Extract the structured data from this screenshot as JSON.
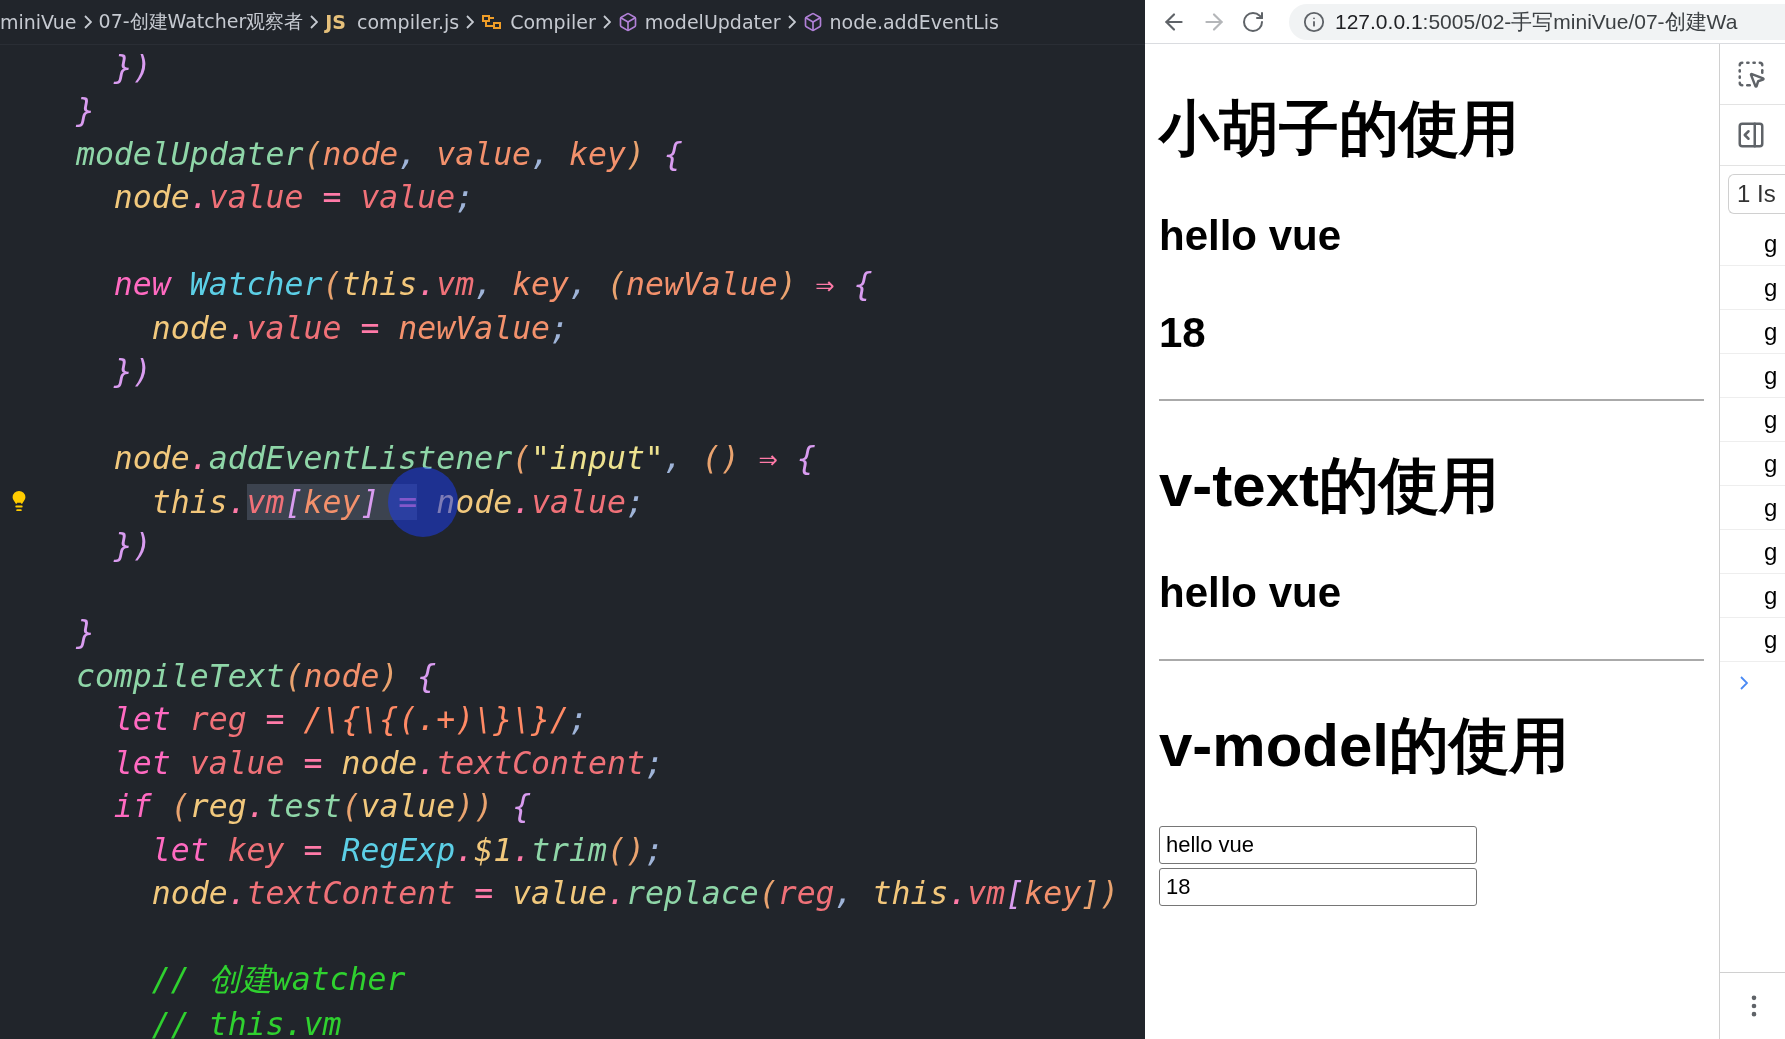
{
  "editor": {
    "breadcrumb": [
      {
        "kind": "folder",
        "label": "miniVue"
      },
      {
        "kind": "folder",
        "label": "07-创建Watcher观察者"
      },
      {
        "kind": "file",
        "badge": "JS",
        "label": "compiler.js"
      },
      {
        "kind": "class",
        "label": "Compiler"
      },
      {
        "kind": "method",
        "label": "modelUpdater"
      },
      {
        "kind": "method",
        "label": "node.addEventLis"
      }
    ],
    "lines": [
      {
        "children": [
          {
            "hint": false,
            "tokens": [
              {
                "text": "})",
                "kind": "brace"
              }
            ]
          }
        ]
      },
      {
        "hint": false,
        "tokens": [
          {
            "text": "}",
            "kind": "brace"
          }
        ]
      },
      {
        "hint": false,
        "tokens": [
          {
            "text": "modelUpdater",
            "kind": "fn"
          },
          {
            "text": "(",
            "kind": "paren"
          },
          {
            "text": "node",
            "kind": "param"
          },
          {
            "text": ", ",
            "kind": "punct"
          },
          {
            "text": "value",
            "kind": "param"
          },
          {
            "text": ", ",
            "kind": "punct"
          },
          {
            "text": "key",
            "kind": "param"
          },
          {
            "text": ")",
            "kind": "paren"
          },
          {
            "text": " {",
            "kind": "brace"
          }
        ],
        "children": [
          {
            "hint": false,
            "tokens": [
              {
                "text": "node",
                "kind": "var"
              },
              {
                "text": ".",
                "kind": "op"
              },
              {
                "text": "value",
                "kind": "prop"
              },
              {
                "text": " = ",
                "kind": "op"
              },
              {
                "text": "value",
                "kind": "prop"
              },
              {
                "text": ";",
                "kind": "punct"
              }
            ]
          },
          {
            "hint": false
          },
          {
            "hint": false,
            "tokens": [
              {
                "text": "new",
                "kind": "kw"
              },
              {
                "text": " Watcher",
                "kind": "cls"
              },
              {
                "text": "(",
                "kind": "paren"
              },
              {
                "text": "this",
                "kind": "this"
              },
              {
                "text": ".",
                "kind": "op"
              },
              {
                "text": "vm",
                "kind": "prop"
              },
              {
                "text": ", ",
                "kind": "punct"
              },
              {
                "text": "key",
                "kind": "param"
              },
              {
                "text": ", ",
                "kind": "punct"
              },
              {
                "text": "(",
                "kind": "paren"
              },
              {
                "text": "newValue",
                "kind": "param"
              },
              {
                "text": ")",
                "kind": "paren"
              },
              {
                "text": " ⇒ ",
                "kind": "op"
              },
              {
                "text": "{",
                "kind": "brace"
              }
            ],
            "children": [
              {
                "hint": false,
                "tokens": [
                  {
                    "text": "node",
                    "kind": "var"
                  },
                  {
                    "text": ".",
                    "kind": "op"
                  },
                  {
                    "text": "value",
                    "kind": "prop"
                  },
                  {
                    "text": " = ",
                    "kind": "op"
                  },
                  {
                    "text": "newValue",
                    "kind": "param"
                  },
                  {
                    "text": ";",
                    "kind": "punct"
                  }
                ]
              }
            ]
          },
          {
            "hint": false,
            "tokens": [
              {
                "text": "})",
                "kind": "brace"
              }
            ]
          },
          {
            "hint": false
          },
          {
            "hint": false,
            "tokens": [
              {
                "text": "node",
                "kind": "var"
              },
              {
                "text": ".",
                "kind": "op"
              },
              {
                "text": "addEventListener",
                "kind": "fn"
              },
              {
                "text": "(",
                "kind": "paren"
              },
              {
                "text": "\"input\"",
                "kind": "str"
              },
              {
                "text": ", ",
                "kind": "punct"
              },
              {
                "text": "()",
                "kind": "paren"
              },
              {
                "text": " ⇒ ",
                "kind": "op"
              },
              {
                "text": "{",
                "kind": "brace"
              }
            ],
            "children": [
              {
                "hint": true,
                "tokens": [
                  {
                    "text": "this",
                    "kind": "this"
                  },
                  {
                    "text": ".",
                    "kind": "op"
                  },
                  {
                    "text": "vm",
                    "kind": "prop",
                    "selected": true
                  },
                  {
                    "text": "[",
                    "kind": "brace",
                    "selected": true
                  },
                  {
                    "text": "key",
                    "kind": "param",
                    "selected": true
                  },
                  {
                    "text": "]",
                    "kind": "brace",
                    "selected": true
                  },
                  {
                    "text": " =",
                    "kind": "op",
                    "selected": true
                  },
                  {
                    "text": " node",
                    "kind": "var"
                  },
                  {
                    "text": ".",
                    "kind": "op"
                  },
                  {
                    "text": "value",
                    "kind": "prop"
                  },
                  {
                    "text": ";",
                    "kind": "punct"
                  }
                ]
              }
            ]
          },
          {
            "hint": false,
            "tokens": [
              {
                "text": "})",
                "kind": "brace"
              }
            ]
          },
          {
            "hint": false
          }
        ]
      },
      {
        "hint": false,
        "tokens": [
          {
            "text": "}",
            "kind": "brace"
          }
        ]
      },
      {
        "hint": false,
        "tokens": [
          {
            "text": "compileText",
            "kind": "fn"
          },
          {
            "text": "(",
            "kind": "paren"
          },
          {
            "text": "node",
            "kind": "param"
          },
          {
            "text": ")",
            "kind": "paren"
          },
          {
            "text": " {",
            "kind": "brace"
          }
        ],
        "children": [
          {
            "hint": false,
            "tokens": [
              {
                "text": "let",
                "kind": "kw"
              },
              {
                "text": " reg",
                "kind": "prop"
              },
              {
                "text": " = ",
                "kind": "op"
              },
              {
                "text": "/\\{\\{(.+)\\}\\}/",
                "kind": "regex"
              },
              {
                "text": ";",
                "kind": "punct"
              }
            ]
          },
          {
            "hint": false,
            "tokens": [
              {
                "text": "let",
                "kind": "kw"
              },
              {
                "text": " value",
                "kind": "prop"
              },
              {
                "text": " = ",
                "kind": "op"
              },
              {
                "text": "node",
                "kind": "var"
              },
              {
                "text": ".",
                "kind": "op"
              },
              {
                "text": "textContent",
                "kind": "prop"
              },
              {
                "text": ";",
                "kind": "punct"
              }
            ]
          },
          {
            "hint": false,
            "tokens": [
              {
                "text": "if",
                "kind": "kw"
              },
              {
                "text": " (",
                "kind": "paren"
              },
              {
                "text": "reg",
                "kind": "var"
              },
              {
                "text": ".",
                "kind": "op"
              },
              {
                "text": "test",
                "kind": "fn"
              },
              {
                "text": "(",
                "kind": "paren"
              },
              {
                "text": "value",
                "kind": "var"
              },
              {
                "text": "))",
                "kind": "paren"
              },
              {
                "text": " {",
                "kind": "brace"
              }
            ],
            "children": [
              {
                "hint": false,
                "tokens": [
                  {
                    "text": "let",
                    "kind": "kw"
                  },
                  {
                    "text": " key",
                    "kind": "prop"
                  },
                  {
                    "text": " = ",
                    "kind": "op"
                  },
                  {
                    "text": "RegExp",
                    "kind": "cls"
                  },
                  {
                    "text": ".",
                    "kind": "op"
                  },
                  {
                    "text": "$1",
                    "kind": "var"
                  },
                  {
                    "text": ".",
                    "kind": "op"
                  },
                  {
                    "text": "trim",
                    "kind": "fn"
                  },
                  {
                    "text": "()",
                    "kind": "paren"
                  },
                  {
                    "text": ";",
                    "kind": "punct"
                  }
                ]
              },
              {
                "hint": false,
                "tokens": [
                  {
                    "text": "node",
                    "kind": "var"
                  },
                  {
                    "text": ".",
                    "kind": "op"
                  },
                  {
                    "text": "textContent",
                    "kind": "prop"
                  },
                  {
                    "text": " = ",
                    "kind": "op"
                  },
                  {
                    "text": "value",
                    "kind": "var"
                  },
                  {
                    "text": ".",
                    "kind": "op"
                  },
                  {
                    "text": "replace",
                    "kind": "fn"
                  },
                  {
                    "text": "(",
                    "kind": "paren"
                  },
                  {
                    "text": "reg",
                    "kind": "prop"
                  },
                  {
                    "text": ", ",
                    "kind": "punct"
                  },
                  {
                    "text": "this",
                    "kind": "this"
                  },
                  {
                    "text": ".",
                    "kind": "op"
                  },
                  {
                    "text": "vm",
                    "kind": "prop"
                  },
                  {
                    "text": "[",
                    "kind": "brace"
                  },
                  {
                    "text": "key",
                    "kind": "param"
                  },
                  {
                    "text": "])",
                    "kind": "paren"
                  }
                ]
              },
              {
                "hint": false
              },
              {
                "hint": false,
                "tokens": [
                  {
                    "text": "// 创建watcher",
                    "kind": "comment"
                  }
                ]
              },
              {
                "hint": false,
                "tokens": [
                  {
                    "text": "// this.vm",
                    "kind": "comment"
                  }
                ]
              }
            ]
          }
        ]
      }
    ]
  },
  "browser": {
    "back": {
      "disabled": false
    },
    "forward": {
      "disabled": true
    },
    "url_host": "127.0.0.1",
    "url_path": ":5005/02-手写miniVue/07-创建Wa",
    "page": [
      {
        "kind": "h1",
        "text": "小胡子的使用"
      },
      {
        "kind": "h2",
        "text": "hello vue"
      },
      {
        "kind": "h2",
        "text": "18"
      },
      {
        "kind": "hr"
      },
      {
        "kind": "h1",
        "text": "v-text的使用"
      },
      {
        "kind": "h2",
        "text": "hello vue"
      },
      {
        "kind": "hr"
      },
      {
        "kind": "h1",
        "text": "v-model的使用"
      },
      {
        "kind": "input",
        "value": "hello vue"
      },
      {
        "kind": "input",
        "value": "18"
      }
    ],
    "devtools": {
      "tab": "1 Is",
      "rows": [
        "g",
        "g",
        "g",
        "g",
        "g",
        "g",
        "g",
        "g",
        "g",
        "g"
      ]
    }
  }
}
